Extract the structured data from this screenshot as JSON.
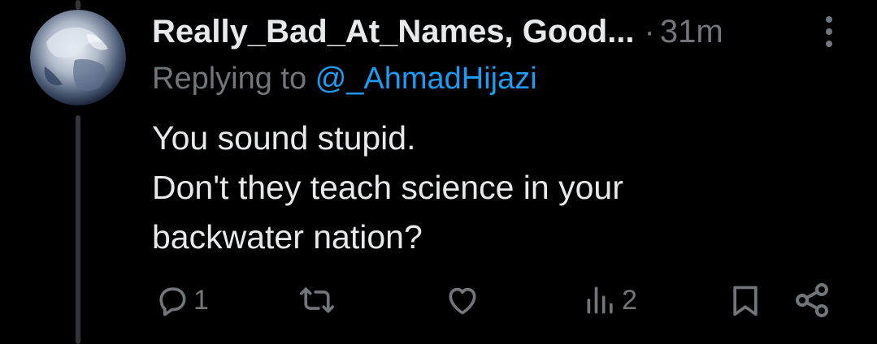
{
  "post": {
    "author": "Really_Bad_At_Names, Good...",
    "separator": "·",
    "time": "31m",
    "replying_prefix": "Replying to",
    "replying_handle": "@_AhmadHijazi",
    "text": "You sound stupid.\nDon't they teach science in your\nbackwater nation?"
  },
  "actions": {
    "reply_count": "1",
    "views_count": "2"
  },
  "icons": {
    "reply": "reply-icon",
    "repost": "repost-icon",
    "like": "like-icon",
    "views": "views-icon",
    "bookmark": "bookmark-icon",
    "share": "share-icon",
    "more": "more-icon"
  },
  "colors": {
    "background": "#000000",
    "text": "#e7e9ea",
    "muted": "#71767b",
    "link": "#1d9bf0",
    "thread_line": "#333639"
  }
}
